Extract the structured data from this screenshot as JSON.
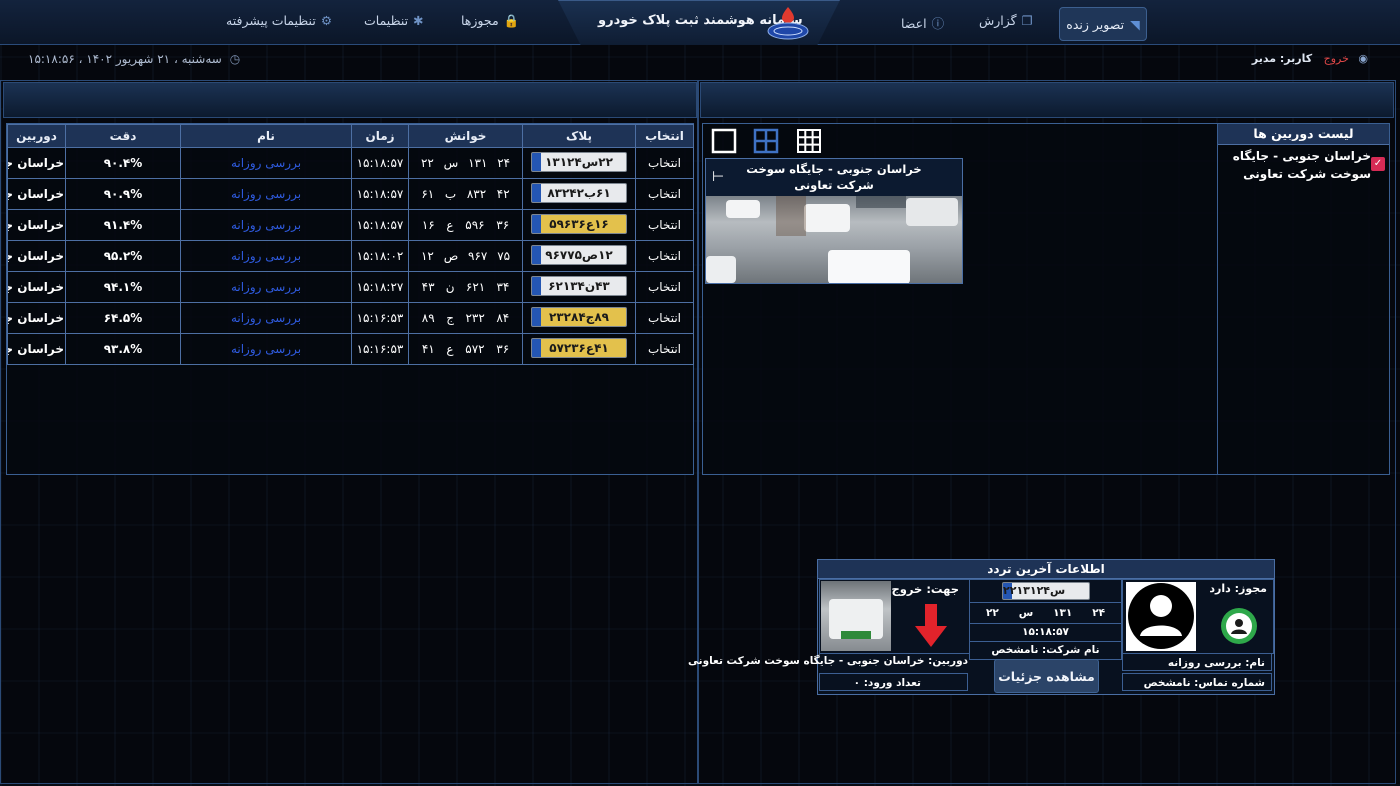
{
  "header": {
    "app_title": "سامانه هوشمند ثبت پلاک خودرو",
    "nav": {
      "live": "تصویر زنده",
      "report": "گزارش",
      "members": "اعضا",
      "permits": "مجوزها",
      "settings": "تنظیمات",
      "advanced": "تنظیمات پیشرفته"
    },
    "datetime": "سه‌شنبه ، ۲۱ شهریور ۱۴۰۲ ، ۱۵:۱۸:۵۶",
    "user_label": "کاربر: مدیر",
    "logout": "خروج"
  },
  "table": {
    "columns": {
      "select": "انتخاب",
      "plate": "پلاک",
      "reading": "خوانش",
      "time": "زمان",
      "name": "نام",
      "accuracy": "دقت",
      "camera": "دوربین"
    },
    "rows": [
      {
        "select": "انتخاب",
        "plate_text": "۲۲س۱۳۱۲۴",
        "plate_color": "white",
        "r1": "۲۴",
        "r2": "۱۳۱",
        "r3": "س",
        "r4": "۲۲",
        "time": "۱۵:۱۸:۵۷",
        "name": "بررسی روزانه",
        "accuracy": "۹۰.۴%",
        "camera": "خراسان جنو"
      },
      {
        "select": "انتخاب",
        "plate_text": "۶۱ب۸۳۲۴۲",
        "plate_color": "white",
        "r1": "۴۲",
        "r2": "۸۳۲",
        "r3": "ب",
        "r4": "۶۱",
        "time": "۱۵:۱۸:۵۷",
        "name": "بررسی روزانه",
        "accuracy": "۹۰.۹%",
        "camera": "خراسان جنو"
      },
      {
        "select": "انتخاب",
        "plate_text": "۱۶ع۵۹۶۳۶",
        "plate_color": "yellow",
        "r1": "۳۶",
        "r2": "۵۹۶",
        "r3": "ع",
        "r4": "۱۶",
        "time": "۱۵:۱۸:۵۷",
        "name": "بررسی روزانه",
        "accuracy": "۹۱.۴%",
        "camera": "خراسان جنو"
      },
      {
        "select": "انتخاب",
        "plate_text": "۱۲ص۹۶۷۷۵",
        "plate_color": "white",
        "r1": "۷۵",
        "r2": "۹۶۷",
        "r3": "ص",
        "r4": "۱۲",
        "time": "۱۵:۱۸:۰۲",
        "name": "بررسی روزانه",
        "accuracy": "۹۵.۲%",
        "camera": "خراسان جنو"
      },
      {
        "select": "انتخاب",
        "plate_text": "۴۳ن۶۲۱۳۴",
        "plate_color": "white",
        "r1": "۳۴",
        "r2": "۶۲۱",
        "r3": "ن",
        "r4": "۴۳",
        "time": "۱۵:۱۸:۲۷",
        "name": "بررسی روزانه",
        "accuracy": "۹۴.۱%",
        "camera": "خراسان جنو"
      },
      {
        "select": "انتخاب",
        "plate_text": "۸۹ج۲۳۲۸۴",
        "plate_color": "yellow",
        "r1": "۸۴",
        "r2": "۲۳۲",
        "r3": "ج",
        "r4": "۸۹",
        "time": "۱۵:۱۶:۵۳",
        "name": "بررسی روزانه",
        "accuracy": "۶۴.۵%",
        "camera": "خراسان جنو"
      },
      {
        "select": "انتخاب",
        "plate_text": "۴۱ع۵۷۲۳۶",
        "plate_color": "yellow",
        "r1": "۳۶",
        "r2": "۵۷۲",
        "r3": "ع",
        "r4": "۴۱",
        "time": "۱۵:۱۶:۵۳",
        "name": "بررسی روزانه",
        "accuracy": "۹۳.۸%",
        "camera": "خراسان جنو"
      }
    ]
  },
  "camera_view": {
    "tile_title": "خراسان جنوبی - جایگاه سوخت شرکت تعاونی"
  },
  "camera_list": {
    "header": "لیست دوربین ها",
    "item": "خراسان جنوبی - جایگاه سوخت شرکت تعاونی"
  },
  "last_traffic": {
    "header": "اطلاعات آخرین تردد",
    "permit": "مجوز: دارد",
    "name": "نام: بررسی روزانه",
    "phone": "شماره تماس: نامشخص",
    "plate_text": "۲۲س۱۳۱۲۴",
    "r1": "۲۴",
    "r2": "۱۳۱",
    "r3": "س",
    "r4": "۲۲",
    "time": "۱۵:۱۸:۵۷",
    "company": "نام شرکت: نامشخص",
    "details_button": "مشاهده جزئیات",
    "direction": "جهت: خروج",
    "camera": "دوربین: خراسان جنوبی - جایگاه سوخت شرکت تعاونی",
    "entry_count": "تعداد ورود: ۰"
  }
}
